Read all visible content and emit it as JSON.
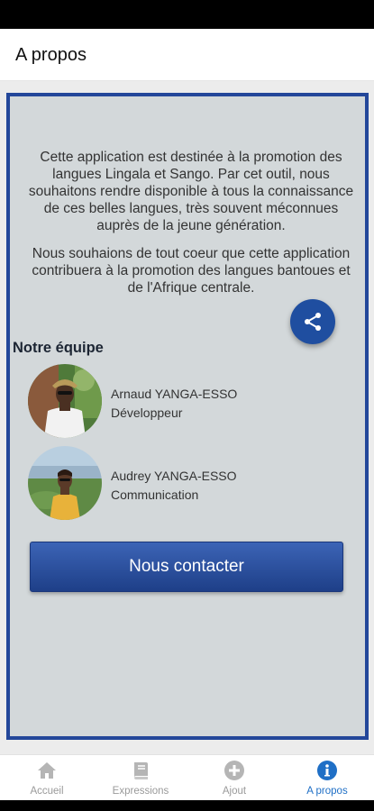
{
  "app_bar": {
    "title": "A propos"
  },
  "intro": {
    "paragraph1": "Cette application est destinée à la promotion des langues Lingala et Sango. Par cet outil, nous souhaitons rendre disponible à tous la connaissance de ces belles langues, très souvent méconnues auprès de la jeune génération.",
    "paragraph2": "Nous souhaions de tout coeur que cette application contribuera à la promotion des langues bantoues et de l'Afrique centrale."
  },
  "share": {
    "icon": "share-icon"
  },
  "team": {
    "title": "Notre équipe",
    "members": [
      {
        "name": "Arnaud YANGA-ESSO",
        "role": "Développeur"
      },
      {
        "name": "Audrey YANGA-ESSO",
        "role": "Communication"
      }
    ]
  },
  "contact": {
    "label": "Nous contacter"
  },
  "nav": {
    "items": [
      {
        "label": "Accueil",
        "icon": "home-icon"
      },
      {
        "label": "Expressions",
        "icon": "book-icon"
      },
      {
        "label": "Ajout",
        "icon": "plus-circle-icon"
      },
      {
        "label": "A propos",
        "icon": "info-icon",
        "active": true
      }
    ]
  },
  "colors": {
    "accent": "#1f4ea0",
    "card_border": "#23479a",
    "active_nav": "#1f6fc6"
  }
}
